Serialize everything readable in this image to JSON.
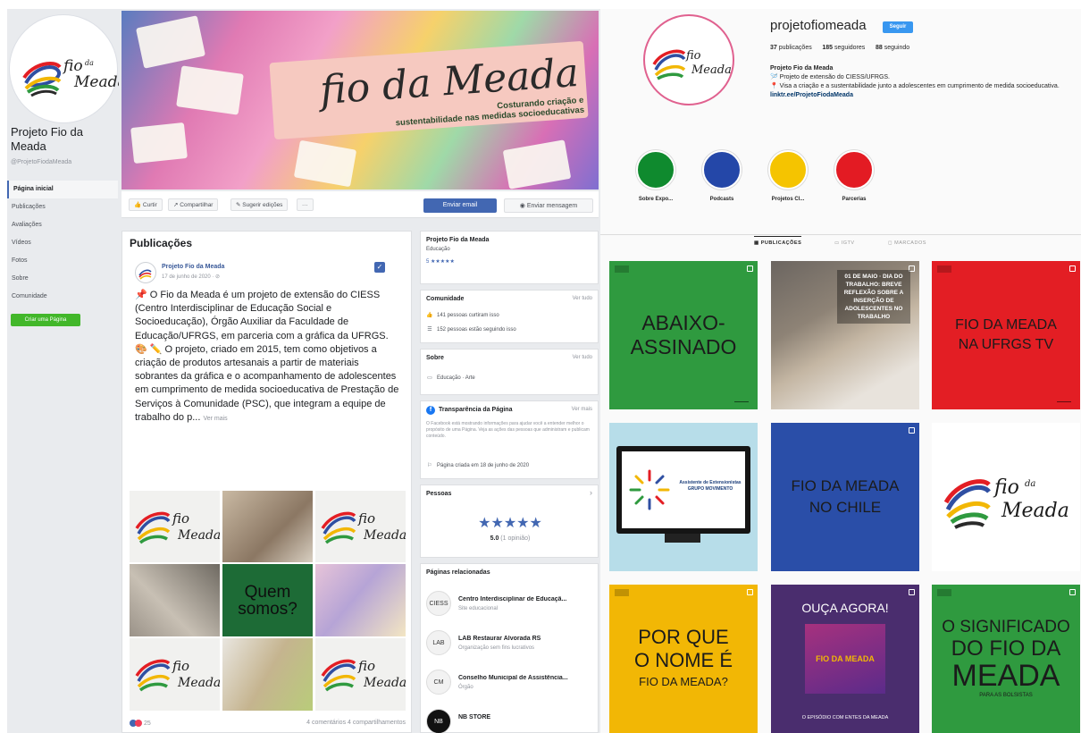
{
  "facebook": {
    "page_name": "Projeto Fio da Meada",
    "handle": "@ProjetoFiodaMeada",
    "nav": [
      "Página inicial",
      "Publicações",
      "Avaliações",
      "Vídeos",
      "Fotos",
      "Sobre",
      "Comunidade"
    ],
    "create_page": "Criar uma Página",
    "cover": {
      "script_title": "fio da Meada",
      "tagline_1": "Costurando criação e",
      "tagline_2": "sustentabilidade nas medidas socioeducativas"
    },
    "actions": {
      "like": "Curtir",
      "share": "Compartilhar",
      "suggest": "Sugerir edições",
      "more": "···",
      "send_email": "Enviar email",
      "send_message": "Enviar mensagem"
    },
    "feed": {
      "title": "Publicações",
      "post": {
        "author": "Projeto Fio da Meada",
        "date": "17 de junho de 2020 · ⊘",
        "paragraph_1": "📌 O Fio da Meada é um projeto de extensão do CIESS (Centro Interdisciplinar de Educação Social e Socioeducação), Órgão Auxiliar da Faculdade de Educação/UFRGS, em parceria com a gráfica da UFRGS.",
        "paragraph_2": "🎨 ✏️ O projeto, criado em 2015, tem como objetivos a criação de produtos artesanais a partir de materiais sobrantes da gráfica e o acompanhamento de adolescentes em cumprimento de medida socioeducativa de Prestação de Serviços à Comunidade (PSC), que integram a equipe de trabalho do p...",
        "see_more": "Ver mais",
        "quem_somos_1": "Quem",
        "quem_somos_2": "somos?",
        "reaction_count": "25",
        "counts": "4 comentários  4 compartilhamentos"
      }
    },
    "about_card": {
      "name": "Projeto Fio da Meada",
      "category": "Educação",
      "rating": "5 ★★★★★"
    },
    "community": {
      "title": "Comunidade",
      "link": "Ver tudo",
      "likes": "141 pessoas curtiram isso",
      "followers": "152 pessoas estão seguindo isso"
    },
    "sobre": {
      "title": "Sobre",
      "link": "Ver tudo",
      "category": "Educação · Arte"
    },
    "transparency": {
      "title": "Transparência da Página",
      "link": "Ver mais",
      "text": "O Facebook está mostrando informações para ajudar você a entender melhor o propósito de uma Página. Veja as ações das pessoas que administram e publicam conteúdo.",
      "created": "Página criada em 18 de junho de 2020"
    },
    "reviews": {
      "title": "Pessoas",
      "stars": "★★★★★",
      "rating": "5.0",
      "rating_label": "(1 opinião)"
    },
    "related": {
      "title": "Páginas relacionadas",
      "items": [
        {
          "icon": "CIESS",
          "name": "Centro Interdisciplinar de Educaçã...",
          "sub": "Site educacional"
        },
        {
          "icon": "LAB",
          "name": "LAB Restaurar Alvorada RS",
          "sub": "Organização sem fins lucrativos"
        },
        {
          "icon": "CM",
          "name": "Conselho Municipal de Assistência...",
          "sub": "Órgão"
        },
        {
          "icon": "NB",
          "name": "NB STORE",
          "sub": ""
        }
      ]
    }
  },
  "instagram": {
    "username": "projetofiomeada",
    "follow": "Seguir",
    "posts_count": "37",
    "posts_label": "publicações",
    "followers_count": "185",
    "followers_label": "seguidores",
    "following_count": "88",
    "following_label": "seguindo",
    "bio_name": "Projeto Fio da Meada",
    "bio_1": "🪡 Projeto de extensão do CIESS/UFRGS.",
    "bio_2": "📍 Visa a criação e a sustentabilidade junto a adolescentes em cumprimento de medida socioeducativa.",
    "bio_link": "linktr.ee/ProjetoFiodaMeada",
    "highlights": [
      {
        "label": "Sobre Expo...",
        "color": "#0f8a2e"
      },
      {
        "label": "Podcasts",
        "color": "#2447a8"
      },
      {
        "label": "Projetos Cl...",
        "color": "#f5c400"
      },
      {
        "label": "Parcerias",
        "color": "#e31b23"
      }
    ],
    "tabs": [
      "PUBLICAÇÕES",
      "IGTV",
      "MARCADOS"
    ],
    "posts": {
      "abaixo_1": "ABAIXO-",
      "abaixo_2": "ASSINADO",
      "photo_caption": "01 DE MAIO · DIA DO TRABALHO: BREVE REFLEXÃO SOBRE A INSERÇÃO DE ADOLESCENTES NO TRABALHO",
      "ufrgs_1": "FIO DA MEADA",
      "ufrgs_2": "NA UFRGS TV",
      "monitor_1": "Assistente de Extensionistas",
      "monitor_2": "GRUPO MOVIMENTO",
      "chile_1": "FIO DA MEADA",
      "chile_2": "NO CHILE",
      "porque_1": "POR QUE",
      "porque_2": "O NOME É",
      "porque_3": "FIO DA MEADA?",
      "ouca_1": "OUÇA AGORA!",
      "ouca_2": "O EPISÓDIO COM ENTES DA MEADA",
      "ouca_badge": "FIO DA MEADA",
      "signif_1": "O SIGNIFICADO",
      "signif_2": "DO FIO DA",
      "signif_3": "MEADA",
      "signif_4": "PARA AS BOLSISTAS"
    }
  },
  "logo_colors": {
    "a": "#2f4fa2",
    "b": "#e31e24",
    "c": "#f2b705",
    "d": "#2f9a3f",
    "e": "#2a2a2a"
  }
}
